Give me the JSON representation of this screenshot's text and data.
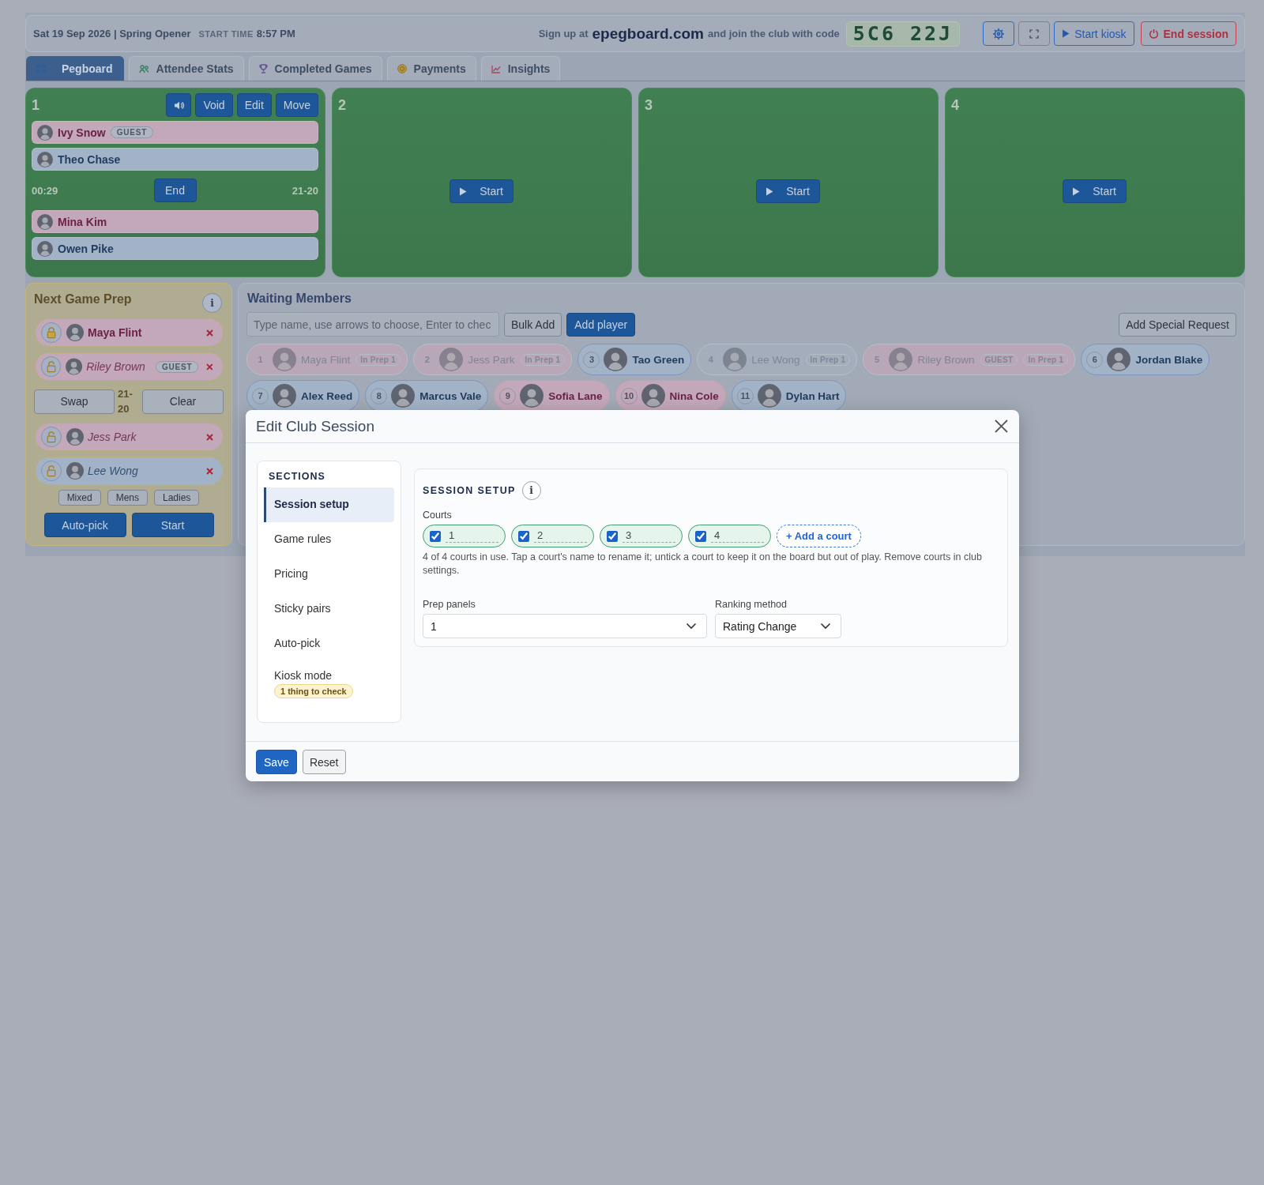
{
  "header": {
    "date_title": "Sat 19 Sep 2026 | Spring Opener",
    "start_time_label": "START TIME",
    "start_time": "8:57 PM",
    "signup_prefix": "Sign up at",
    "signup_site": "epegboard.com",
    "signup_suffix": "and join the club with code",
    "club_code": "5C6 22J",
    "buttons": [
      {
        "kind": "settings"
      },
      {
        "kind": "fullscreen"
      },
      {
        "kind": "kiosk",
        "label": "Start kiosk"
      },
      {
        "kind": "end",
        "label": "End session"
      }
    ]
  },
  "tabs": [
    {
      "kind": "grid",
      "label": "Pegboard",
      "selected": true
    },
    {
      "kind": "people",
      "label": "Attendee Stats",
      "selected": false
    },
    {
      "kind": "trophy",
      "label": "Completed Games",
      "selected": false
    },
    {
      "kind": "coin",
      "label": "Payments",
      "selected": false
    },
    {
      "kind": "chart",
      "label": "Insights",
      "selected": false
    }
  ],
  "courts": [
    {
      "kind": "active",
      "number": "1",
      "controls": [
        "Void",
        "Edit",
        "Move"
      ],
      "team_a": [
        {
          "name": "Ivy Snow",
          "color": "#c3a8ba",
          "badge": "GUEST"
        },
        {
          "name": "Theo Chase",
          "color": "#a3b3c7"
        }
      ],
      "timer": "00:29",
      "end_label": "End",
      "score": "21-20",
      "team_b": [
        {
          "name": "Mina Kim",
          "color": "#c3a8ba"
        },
        {
          "name": "Owen Pike",
          "color": "#a3b3c7"
        }
      ]
    },
    {
      "kind": "empty",
      "number": "2",
      "start_label": "Start"
    },
    {
      "kind": "empty",
      "number": "3",
      "start_label": "Start"
    },
    {
      "kind": "empty",
      "number": "4",
      "start_label": "Start"
    }
  ],
  "prep": {
    "title": "Next Game Prep",
    "info": "i",
    "team_a": [
      {
        "name": "Maya Flint",
        "color": "#c3a8ba",
        "locked": true
      },
      {
        "name": "Riley Brown",
        "color": "#c3a8ba",
        "locked": false,
        "badge": "GUEST"
      }
    ],
    "swap_label": "Swap",
    "score": "21-20",
    "clear_label": "Clear",
    "team_b": [
      {
        "name": "Jess Park",
        "color": "#c3a8ba",
        "locked": false
      },
      {
        "name": "Lee Wong",
        "color": "#a3b3c7",
        "locked": false
      }
    ],
    "filters": [
      "Mixed",
      "Mens",
      "Ladies"
    ],
    "actions": [
      "Auto-pick",
      "Start"
    ]
  },
  "waiting": {
    "title": "Waiting Members",
    "search_placeholder": "Type name, use arrows to choose, Enter to chec",
    "bulk_add": "Bulk Add",
    "add_player": "Add player",
    "special_request": "Add Special Request",
    "members": [
      {
        "number": "1",
        "name": "Maya Flint",
        "color": "#b9a6b6",
        "in_prep": true,
        "tags": [
          "In Prep 1"
        ]
      },
      {
        "number": "2",
        "name": "Jess Park",
        "color": "#b9a6b6",
        "in_prep": true,
        "tags": [
          "In Prep 1"
        ]
      },
      {
        "number": "3",
        "name": "Tao Green",
        "color": "#a3b3c7",
        "in_prep": false
      },
      {
        "number": "4",
        "name": "Lee Wong",
        "color": "#a4adbb",
        "in_prep": true,
        "tags": [
          "In Prep 1"
        ]
      },
      {
        "number": "5",
        "name": "Riley Brown",
        "color": "#b9a6b6",
        "in_prep": true,
        "tags": [
          "GUEST",
          "In Prep 1"
        ]
      },
      {
        "number": "6",
        "name": "Jordan Blake",
        "color": "#a3b3c7",
        "in_prep": false
      },
      {
        "number": "7",
        "name": "Alex Reed",
        "color": "#a3b3c7",
        "in_prep": false
      },
      {
        "number": "8",
        "name": "Marcus Vale",
        "color": "#a3b3c7",
        "in_prep": false
      },
      {
        "number": "9",
        "name": "Sofia Lane",
        "color": "#c3a8ba",
        "in_prep": false
      },
      {
        "number": "10",
        "name": "Nina Cole",
        "color": "#c3a8ba",
        "in_prep": false
      },
      {
        "number": "11",
        "name": "Dylan Hart",
        "color": "#a3b3c7",
        "in_prep": false
      }
    ]
  },
  "modal": {
    "title": "Edit Club Session",
    "sections_title": "SECTIONS",
    "sections": [
      {
        "label": "Session setup",
        "selected": true
      },
      {
        "label": "Game rules",
        "selected": false
      },
      {
        "label": "Pricing",
        "selected": false
      },
      {
        "label": "Sticky pairs",
        "selected": false
      },
      {
        "label": "Auto-pick",
        "selected": false
      },
      {
        "label": "Kiosk mode",
        "selected": false,
        "badge": "1 thing to check"
      }
    ],
    "panel_title": "SESSION SETUP",
    "info": "i",
    "courts_label": "Courts",
    "courts": [
      {
        "name": "1",
        "checked": true
      },
      {
        "name": "2",
        "checked": true
      },
      {
        "name": "3",
        "checked": true
      },
      {
        "name": "4",
        "checked": true
      }
    ],
    "add_court": "+ Add a court",
    "help": "4 of 4 courts in use. Tap a court's name to rename it; untick a court to keep it on the board but out of play. Remove courts in club settings.",
    "prep_panels_label": "Prep panels",
    "prep_panels_value": "1",
    "ranking_label": "Ranking method",
    "ranking_value": "Rating Change",
    "save": "Save",
    "reset": "Reset"
  }
}
